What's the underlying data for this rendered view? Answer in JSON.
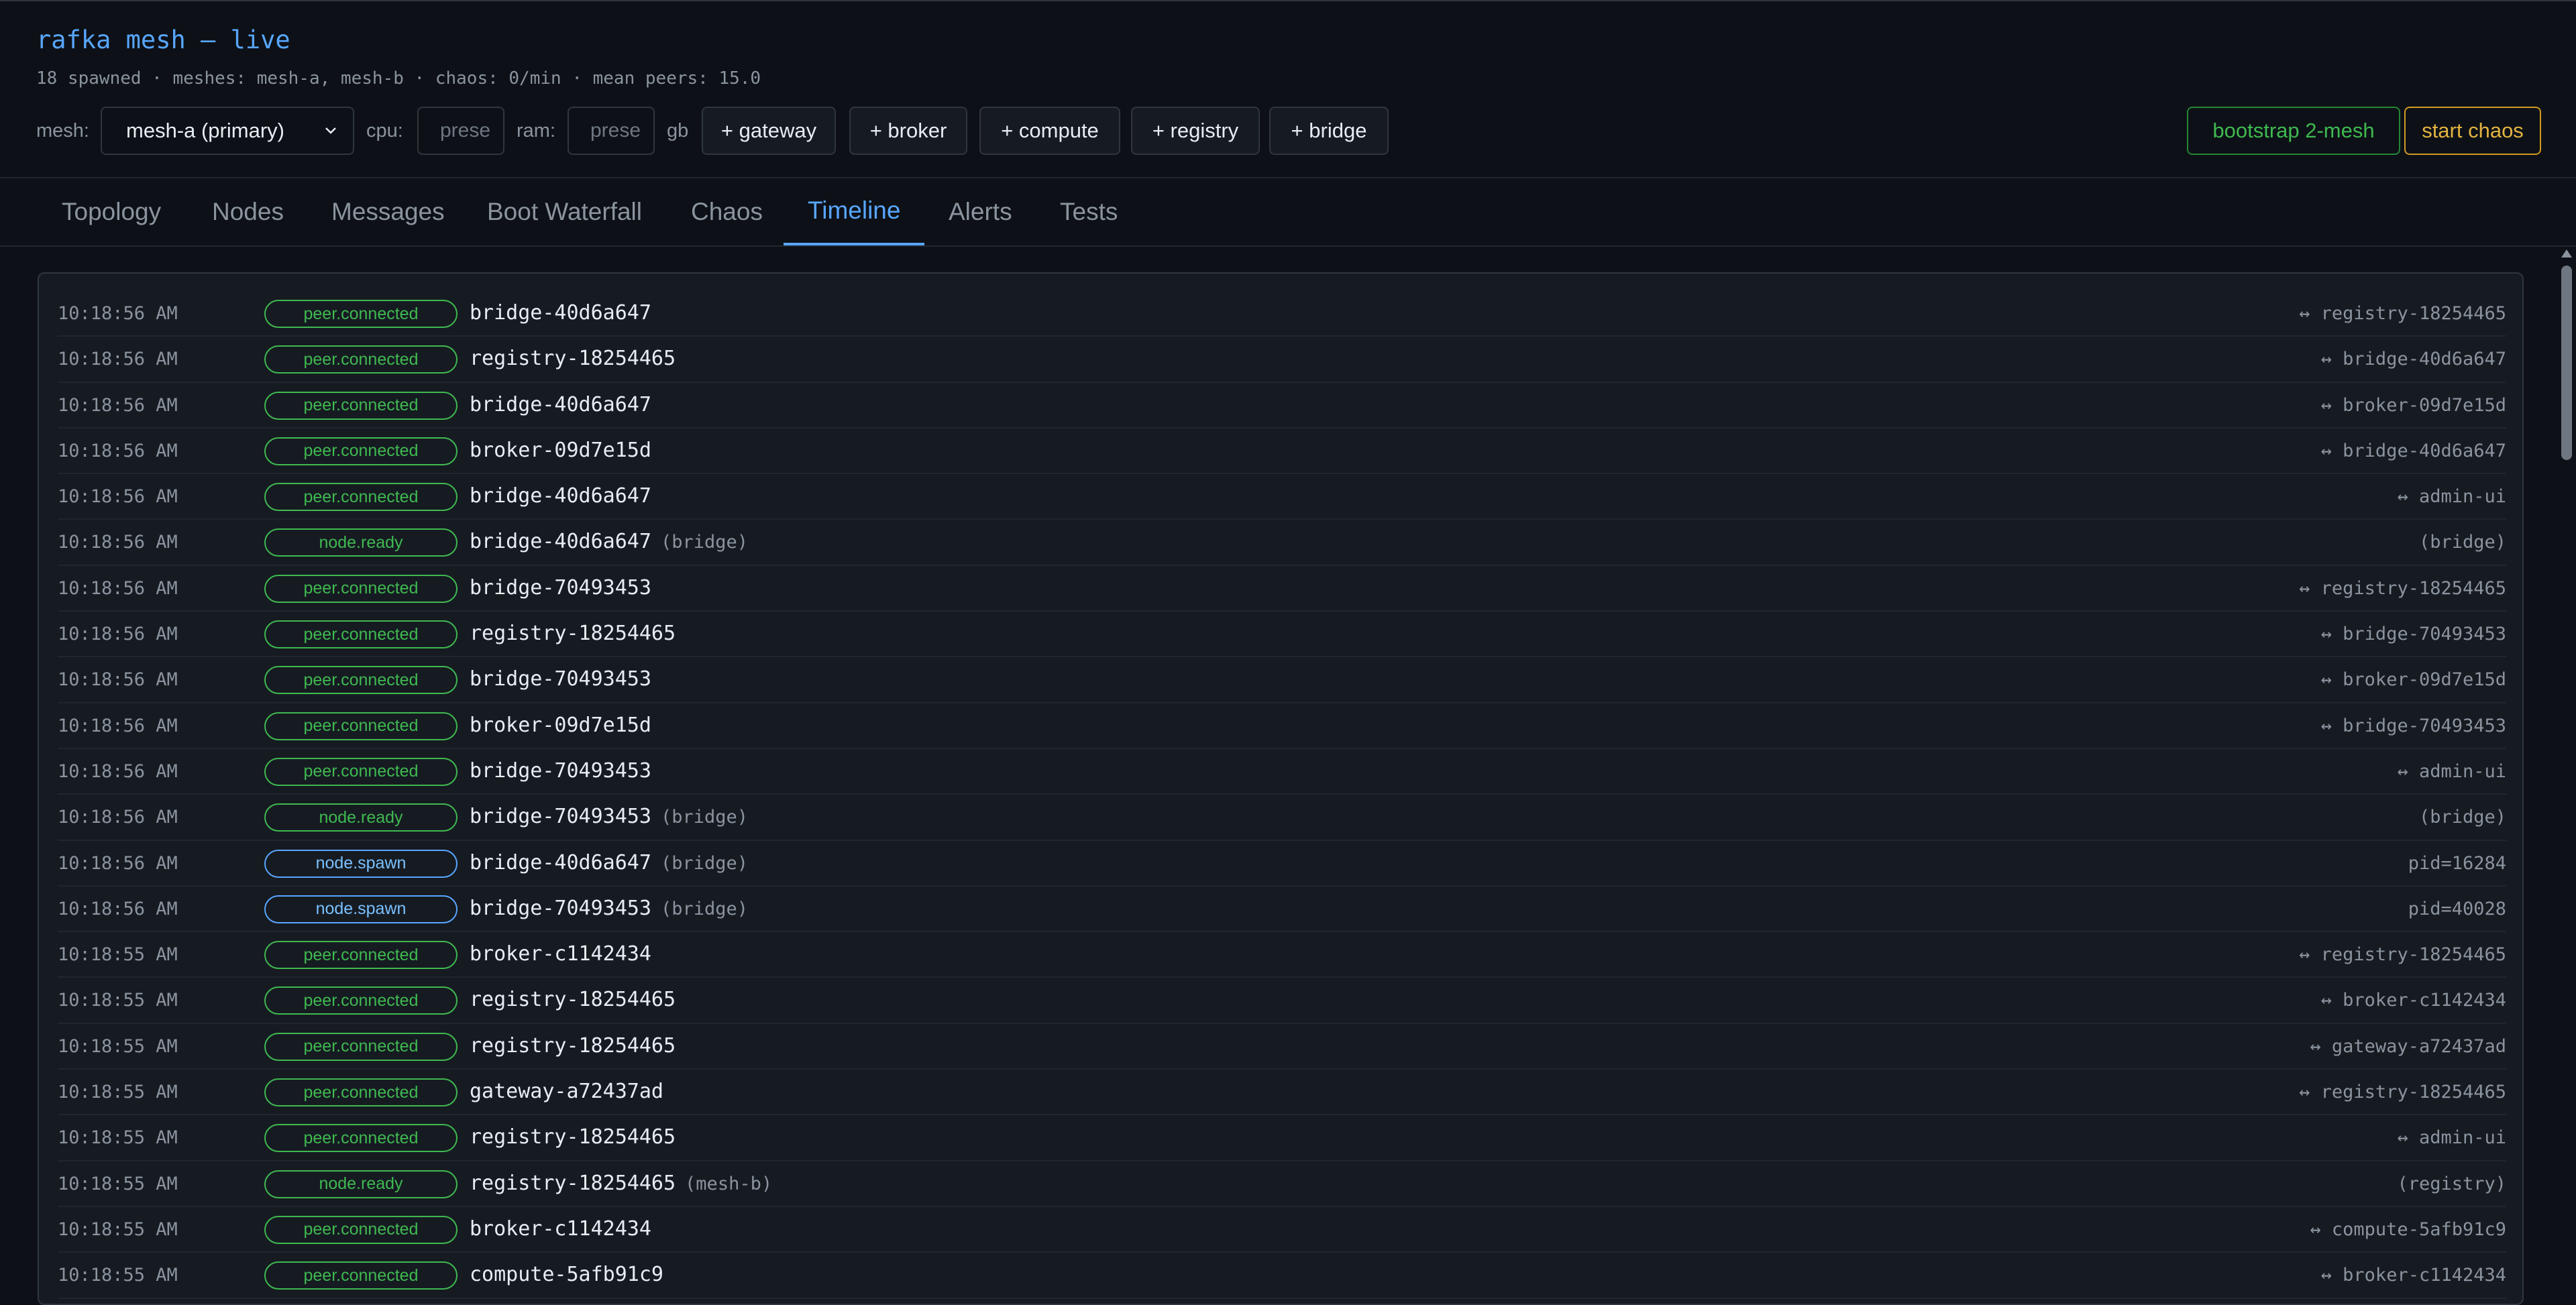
{
  "header": {
    "title": "rafka mesh — live",
    "stats": "18 spawned · meshes: mesh-a, mesh-b · chaos: 0/min · mean peers: 15.0"
  },
  "controls": {
    "mesh_label": "mesh:",
    "mesh_value": "mesh-a (primary)",
    "cpu_label": "cpu:",
    "cpu_placeholder": "prese",
    "ram_label": "ram:",
    "ram_placeholder": "prese",
    "ram_unit": "gb",
    "buttons": [
      "+ gateway",
      "+ broker",
      "+ compute",
      "+ registry",
      "+ bridge"
    ],
    "bootstrap_label": "bootstrap 2-mesh",
    "chaos_label": "start chaos"
  },
  "tabs": [
    {
      "label": "Topology"
    },
    {
      "label": "Nodes"
    },
    {
      "label": "Messages"
    },
    {
      "label": "Boot Waterfall"
    },
    {
      "label": "Chaos"
    },
    {
      "label": "Timeline",
      "active": true
    },
    {
      "label": "Alerts"
    },
    {
      "label": "Tests"
    }
  ],
  "timeline": [
    {
      "time": "10:18:56 AM",
      "event": "peer.connected",
      "node": "bridge-40d6a647",
      "suffix": "",
      "detail": "↔ registry-18254465"
    },
    {
      "time": "10:18:56 AM",
      "event": "peer.connected",
      "node": "registry-18254465",
      "suffix": "",
      "detail": "↔ bridge-40d6a647"
    },
    {
      "time": "10:18:56 AM",
      "event": "peer.connected",
      "node": "bridge-40d6a647",
      "suffix": "",
      "detail": "↔ broker-09d7e15d"
    },
    {
      "time": "10:18:56 AM",
      "event": "peer.connected",
      "node": "broker-09d7e15d",
      "suffix": "",
      "detail": "↔ bridge-40d6a647"
    },
    {
      "time": "10:18:56 AM",
      "event": "peer.connected",
      "node": "bridge-40d6a647",
      "suffix": "",
      "detail": "↔ admin-ui"
    },
    {
      "time": "10:18:56 AM",
      "event": "node.ready",
      "node": "bridge-40d6a647",
      "suffix": "(bridge)",
      "detail": "(bridge)"
    },
    {
      "time": "10:18:56 AM",
      "event": "peer.connected",
      "node": "bridge-70493453",
      "suffix": "",
      "detail": "↔ registry-18254465"
    },
    {
      "time": "10:18:56 AM",
      "event": "peer.connected",
      "node": "registry-18254465",
      "suffix": "",
      "detail": "↔ bridge-70493453"
    },
    {
      "time": "10:18:56 AM",
      "event": "peer.connected",
      "node": "bridge-70493453",
      "suffix": "",
      "detail": "↔ broker-09d7e15d"
    },
    {
      "time": "10:18:56 AM",
      "event": "peer.connected",
      "node": "broker-09d7e15d",
      "suffix": "",
      "detail": "↔ bridge-70493453"
    },
    {
      "time": "10:18:56 AM",
      "event": "peer.connected",
      "node": "bridge-70493453",
      "suffix": "",
      "detail": "↔ admin-ui"
    },
    {
      "time": "10:18:56 AM",
      "event": "node.ready",
      "node": "bridge-70493453",
      "suffix": "(bridge)",
      "detail": "(bridge)"
    },
    {
      "time": "10:18:56 AM",
      "event": "node.spawn",
      "node": "bridge-40d6a647",
      "suffix": "(bridge)",
      "detail": "pid=16284"
    },
    {
      "time": "10:18:56 AM",
      "event": "node.spawn",
      "node": "bridge-70493453",
      "suffix": "(bridge)",
      "detail": "pid=40028"
    },
    {
      "time": "10:18:55 AM",
      "event": "peer.connected",
      "node": "broker-c1142434",
      "suffix": "",
      "detail": "↔ registry-18254465"
    },
    {
      "time": "10:18:55 AM",
      "event": "peer.connected",
      "node": "registry-18254465",
      "suffix": "",
      "detail": "↔ broker-c1142434"
    },
    {
      "time": "10:18:55 AM",
      "event": "peer.connected",
      "node": "registry-18254465",
      "suffix": "",
      "detail": "↔ gateway-a72437ad"
    },
    {
      "time": "10:18:55 AM",
      "event": "peer.connected",
      "node": "gateway-a72437ad",
      "suffix": "",
      "detail": "↔ registry-18254465"
    },
    {
      "time": "10:18:55 AM",
      "event": "peer.connected",
      "node": "registry-18254465",
      "suffix": "",
      "detail": "↔ admin-ui"
    },
    {
      "time": "10:18:55 AM",
      "event": "node.ready",
      "node": "registry-18254465",
      "suffix": "(mesh-b)",
      "detail": "(registry)"
    },
    {
      "time": "10:18:55 AM",
      "event": "peer.connected",
      "node": "broker-c1142434",
      "suffix": "",
      "detail": "↔ compute-5afb91c9"
    },
    {
      "time": "10:18:55 AM",
      "event": "peer.connected",
      "node": "compute-5afb91c9",
      "suffix": "",
      "detail": "↔ broker-c1142434"
    }
  ],
  "colors": {
    "accent": "#58a6ff",
    "connected": "#3fb950",
    "spawn": "#58a6ff",
    "chaos": "#e3b341"
  }
}
